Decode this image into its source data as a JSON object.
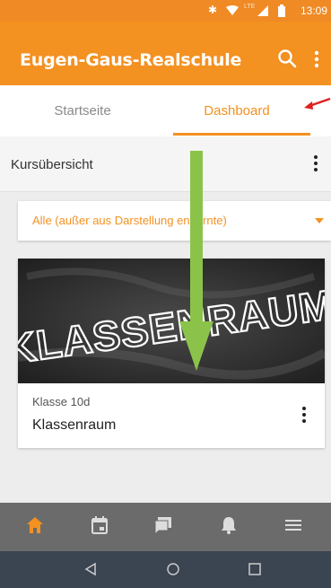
{
  "status_bar": {
    "time": "13:09",
    "network_label": "LTE",
    "icons": [
      "bluetooth-icon",
      "wifi-icon",
      "signal-icon",
      "battery-icon"
    ]
  },
  "app_bar": {
    "title": "Eugen-Gaus-Realschule",
    "icons": [
      "search-icon",
      "more-vert-icon"
    ]
  },
  "tabs": [
    {
      "label": "Startseite",
      "selected": false
    },
    {
      "label": "Dashboard",
      "selected": true
    }
  ],
  "section": {
    "title": "Kursübersicht"
  },
  "filter": {
    "selected": "Alle (außer aus Darstellung entfernte)"
  },
  "course_card": {
    "image_text": "KLASSENRAUM",
    "subtitle": "Klasse 10d",
    "title": "Klassenraum"
  },
  "bottom_nav": {
    "items": [
      "home-icon",
      "calendar-icon",
      "messages-icon",
      "notifications-icon",
      "menu-icon"
    ],
    "active": "home-icon"
  },
  "system_nav": [
    "back-icon",
    "home-circle-icon",
    "recents-icon"
  ],
  "colors": {
    "accent": "#f39121",
    "annotation_arrow_green": "#8bc34a",
    "annotation_arrow_red": "#e02020",
    "bottom_nav": "#6b6b6b",
    "system_bar": "#3b4451"
  }
}
